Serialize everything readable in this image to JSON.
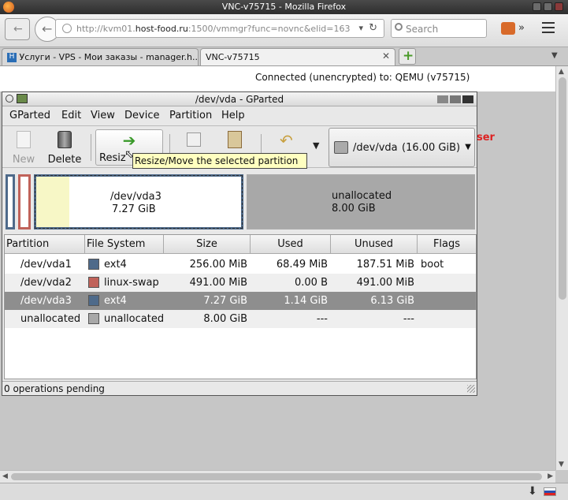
{
  "browser": {
    "window_title": "VNC-v75715 - Mozilla Firefox",
    "url_prefix": "http://kvm01.",
    "url_host": "host-food.ru",
    "url_suffix": ":1500/vmmgr?func=novnc&elid=163",
    "search_placeholder": "Search",
    "tabs": [
      {
        "label": "Услуги - VPS - Мои заказы - manager.h..."
      },
      {
        "label": "VNC-v75715"
      }
    ]
  },
  "vnc": {
    "status": "Connected (unencrypted) to: QEMU (v75715)",
    "bg_text": "ser"
  },
  "gparted": {
    "title": "/dev/vda - GParted",
    "menu": [
      "GParted",
      "Edit",
      "View",
      "Device",
      "Partition",
      "Help"
    ],
    "toolbar": {
      "new": "New",
      "delete": "Delete",
      "resize": "Resiz"
    },
    "device": "/dev/vda",
    "device_size": "(16.00 GiB)",
    "tooltip": "Resize/Move the selected partition",
    "diskmap": {
      "selected_name": "/dev/vda3",
      "selected_size": "7.27 GiB",
      "unalloc_name": "unallocated",
      "unalloc_size": "8.00 GiB"
    },
    "columns": [
      "Partition",
      "File System",
      "Size",
      "Used",
      "Unused",
      "Flags"
    ],
    "rows": [
      {
        "partition": "/dev/vda1",
        "fs": "ext4",
        "color": "#4e6a8a",
        "size": "256.00 MiB",
        "used": "68.49 MiB",
        "unused": "187.51 MiB",
        "flags": "boot"
      },
      {
        "partition": "/dev/vda2",
        "fs": "linux-swap",
        "color": "#c0625a",
        "size": "491.00 MiB",
        "used": "0.00 B",
        "unused": "491.00 MiB",
        "flags": ""
      },
      {
        "partition": "/dev/vda3",
        "fs": "ext4",
        "color": "#4e6a8a",
        "size": "7.27 GiB",
        "used": "1.14 GiB",
        "unused": "6.13 GiB",
        "flags": ""
      },
      {
        "partition": "unallocated",
        "fs": "unallocated",
        "color": "#a8a8a8",
        "size": "8.00 GiB",
        "used": "---",
        "unused": "---",
        "flags": ""
      }
    ],
    "status": "0 operations pending"
  },
  "colors": {
    "selected_row": "#8e8e8e",
    "used_fill": "#f7f7c6",
    "ext4": "#4e6a8a",
    "swap": "#c0625a",
    "unallocated": "#a8a8a8"
  }
}
